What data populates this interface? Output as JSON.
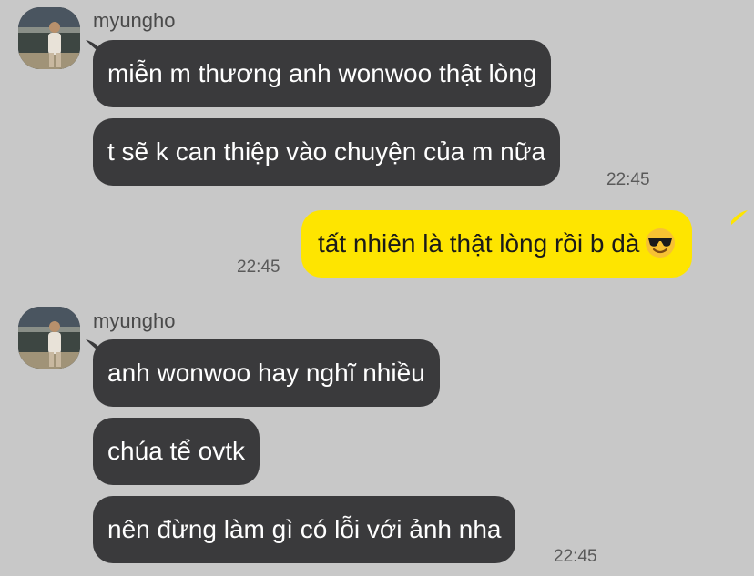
{
  "colors": {
    "background": "#c8c8c8",
    "incoming_bubble": "#3a3a3c",
    "outgoing_bubble": "#fee500"
  },
  "groups": [
    {
      "sender": "myungho",
      "messages": [
        "miễn m thương anh wonwoo thật lòng",
        "t sẽ k can thiệp vào chuyện của m nữa"
      ],
      "time": "22:45"
    },
    {
      "outgoing_message": "tất nhiên là thật lòng rồi b dà",
      "emoji": "smiling-face-with-sunglasses-icon",
      "time": "22:45"
    },
    {
      "sender": "myungho",
      "messages": [
        "anh wonwoo hay nghĩ nhiều",
        "chúa tể ovtk",
        "nên đừng làm gì có lỗi với ảnh nha"
      ],
      "time": "22:45"
    }
  ]
}
